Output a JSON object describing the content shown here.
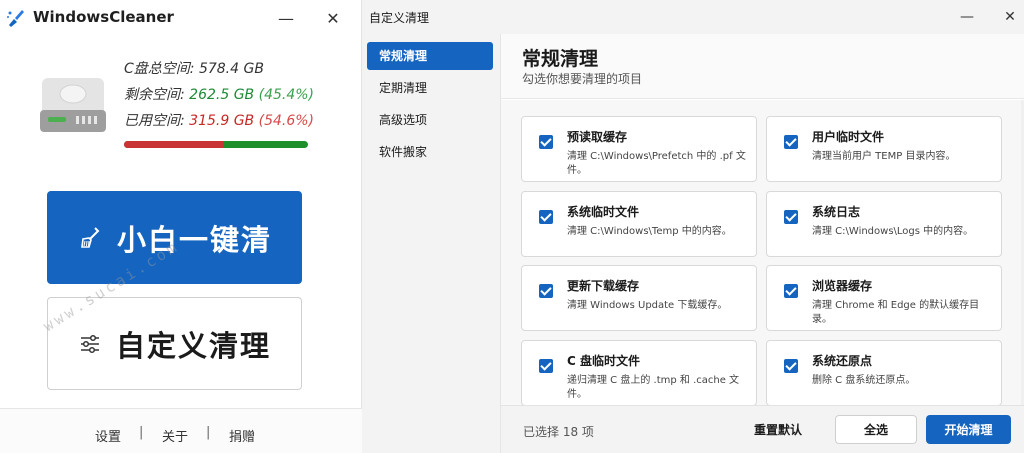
{
  "main_window": {
    "title": "WindowsCleaner",
    "minimize_symbol": "—",
    "close_symbol": "✕",
    "disk": {
      "total_label": "C盘总空间:",
      "total_value": "578.4 GB",
      "free_label": "剩余空间:",
      "free_value": "262.5 GB",
      "free_percent": "(45.4%)",
      "used_label": "已用空间:",
      "used_value": "315.9 GB",
      "used_percent": "(54.6%)",
      "used_fraction": 0.546
    },
    "one_click_button": "小白一键清",
    "custom_button": "自定义清理",
    "footer": {
      "settings": "设置",
      "about": "关于",
      "donate": "捐赠",
      "separator": "|"
    },
    "watermark": "www.sucai.com"
  },
  "custom_window": {
    "title": "自定义清理",
    "minimize_symbol": "—",
    "close_symbol": "✕",
    "nav": [
      "常规清理",
      "定期清理",
      "高级选项",
      "软件搬家"
    ],
    "heading": "常规清理",
    "subheading": "勾选你想要清理的项目",
    "items": [
      {
        "title": "预读取缓存",
        "desc": "清理 C:\\Windows\\Prefetch 中的 .pf 文件。",
        "checked": true
      },
      {
        "title": "用户临时文件",
        "desc": "清理当前用户 TEMP 目录内容。",
        "checked": true
      },
      {
        "title": "系统临时文件",
        "desc": "清理 C:\\Windows\\Temp 中的内容。",
        "checked": true
      },
      {
        "title": "系统日志",
        "desc": "清理 C:\\Windows\\Logs 中的内容。",
        "checked": true
      },
      {
        "title": "更新下载缓存",
        "desc": "清理 Windows Update 下载缓存。",
        "checked": true
      },
      {
        "title": "浏览器缓存",
        "desc": "清理 Chrome 和 Edge 的默认缓存目录。",
        "checked": true
      },
      {
        "title": "C 盘临时文件",
        "desc": "递归清理 C 盘上的 .tmp 和 .cache 文件。",
        "checked": true
      },
      {
        "title": "系统还原点",
        "desc": "删除 C 盘系统还原点。",
        "checked": true
      }
    ],
    "selected_count": "已选择 18 项",
    "reset_button": "重置默认",
    "select_all_button": "全选",
    "start_button": "开始清理"
  },
  "colors": {
    "accent": "#1565c0",
    "free_green": "#1e8a36",
    "used_red": "#c62828"
  }
}
